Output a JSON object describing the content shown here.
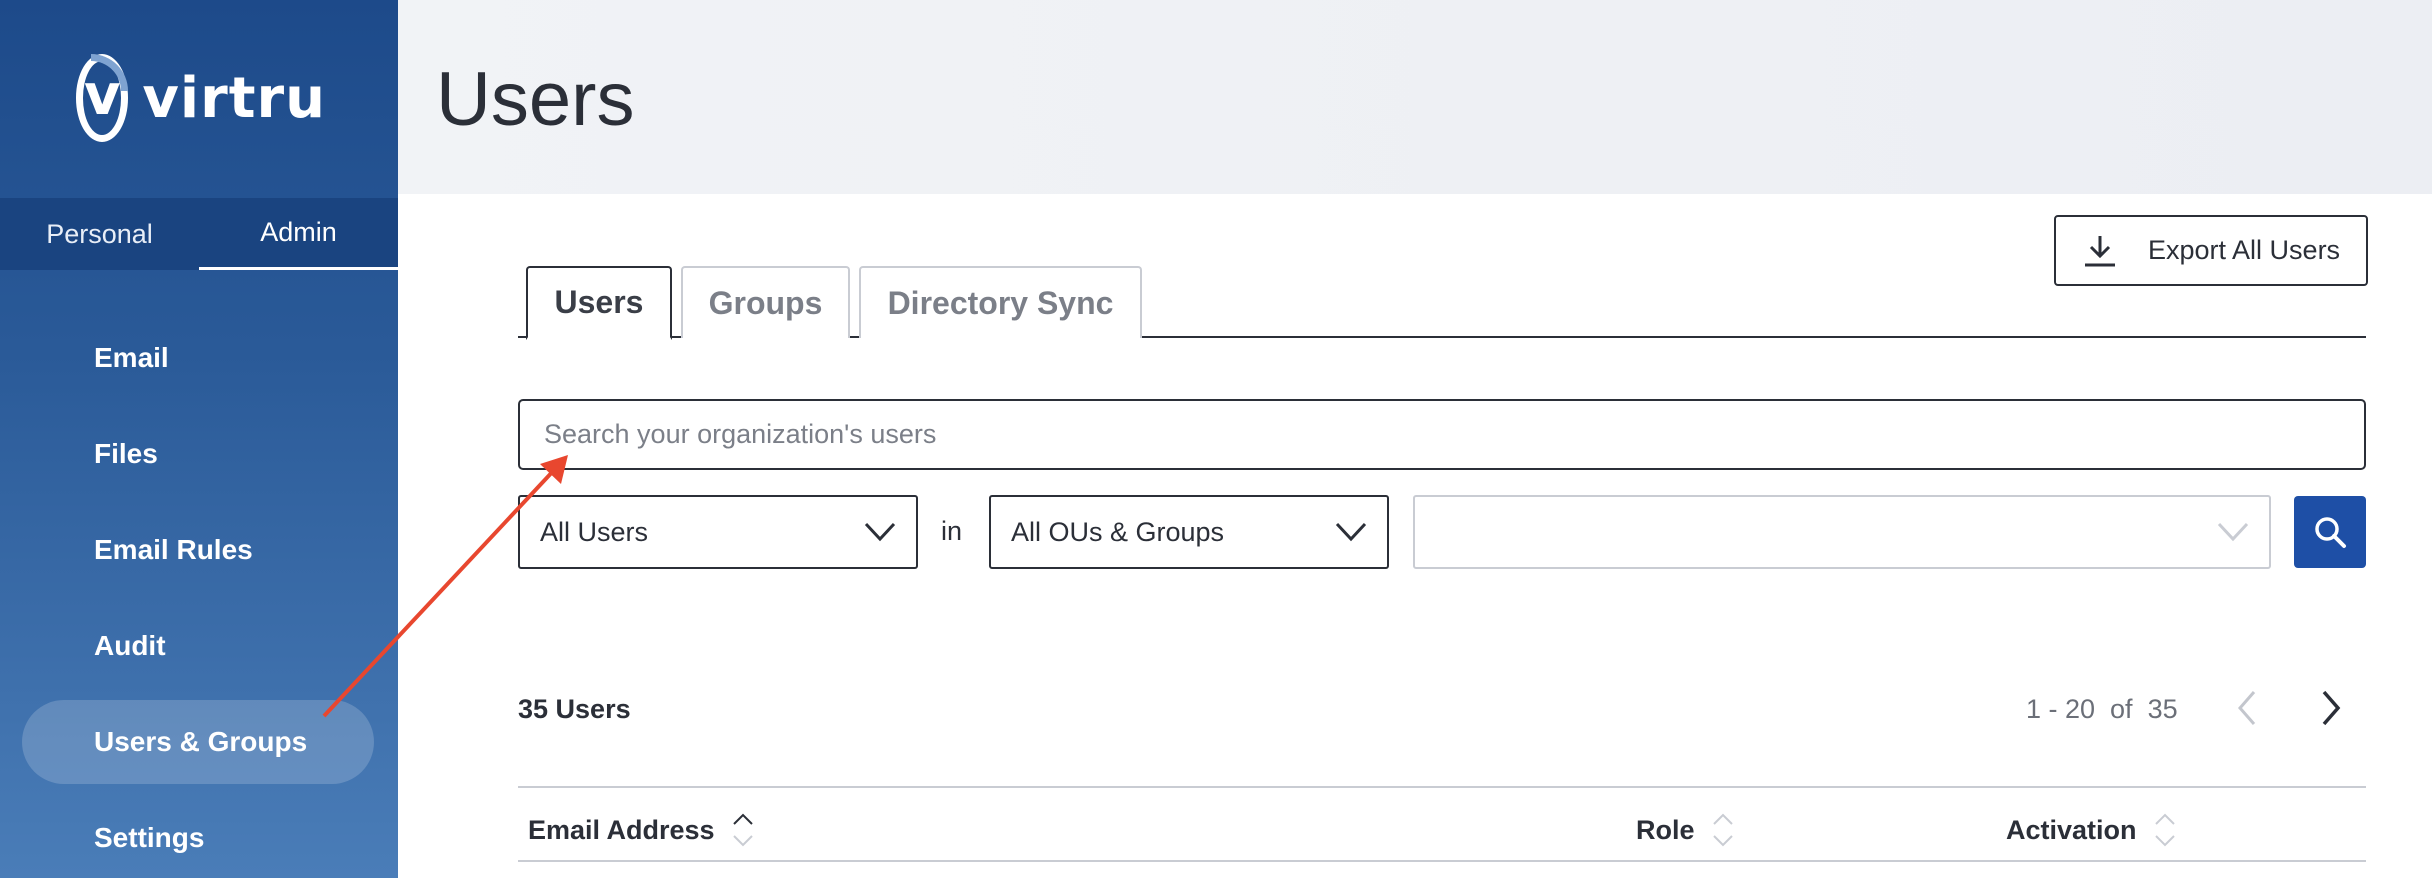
{
  "brand": {
    "name": "virtru",
    "mark": "v"
  },
  "mode_tabs": [
    {
      "label": "Personal",
      "active": false
    },
    {
      "label": "Admin",
      "active": true
    }
  ],
  "sidebar": {
    "items": [
      {
        "label": "Email",
        "active": false
      },
      {
        "label": "Files",
        "active": false
      },
      {
        "label": "Email Rules",
        "active": false
      },
      {
        "label": "Audit",
        "active": false
      },
      {
        "label": "Users & Groups",
        "active": true
      },
      {
        "label": "Settings",
        "active": false
      }
    ]
  },
  "header": {
    "title": "Users"
  },
  "toolbar": {
    "export_label": "Export All Users",
    "export_icon": "download-icon"
  },
  "tabs": [
    {
      "label": "Users",
      "active": true
    },
    {
      "label": "Groups",
      "active": false
    },
    {
      "label": "Directory Sync",
      "active": false
    }
  ],
  "search": {
    "placeholder": "Search your organization's users",
    "value": ""
  },
  "filters": {
    "user_filter": "All Users",
    "in_label": "in",
    "scope_filter": "All OUs & Groups",
    "third_filter": ""
  },
  "results": {
    "count_label": "35 Users",
    "range_label": "1 - 20  of  35"
  },
  "table": {
    "columns": [
      {
        "label": "Email Address"
      },
      {
        "label": "Role"
      },
      {
        "label": "Activation"
      }
    ]
  },
  "colors": {
    "sidebar_top": "#1d4a8a",
    "sidebar_bottom": "#4a7db8",
    "primary_button": "#1e4fa6",
    "annotation_arrow": "#e8472f"
  }
}
